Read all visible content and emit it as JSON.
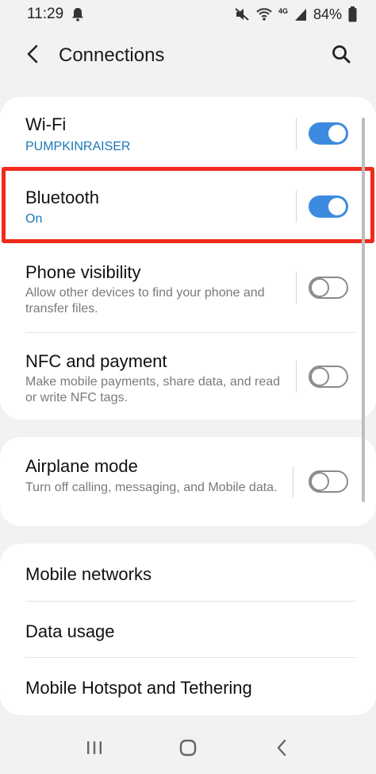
{
  "status_bar": {
    "time": "11:29",
    "network_label": "4G",
    "battery": "84%",
    "icons": [
      "notification-bell-icon",
      "mute-icon",
      "wifi-icon",
      "signal-icon",
      "battery-icon"
    ]
  },
  "header": {
    "title": "Connections",
    "back_icon": "back-arrow-icon",
    "search_icon": "search-icon"
  },
  "settings": {
    "wifi": {
      "title": "Wi-Fi",
      "subtitle": "PUMPKINRAISER",
      "enabled": true
    },
    "bluetooth": {
      "title": "Bluetooth",
      "subtitle": "On",
      "enabled": true
    },
    "phone_visibility": {
      "title": "Phone visibility",
      "description": "Allow other devices to find your phone and transfer files.",
      "enabled": false
    },
    "nfc": {
      "title": "NFC and payment",
      "description": "Make mobile payments, share data, and read or write NFC tags.",
      "enabled": false
    },
    "airplane": {
      "title": "Airplane mode",
      "description": "Turn off calling, messaging, and Mobile data.",
      "enabled": false
    },
    "mobile_networks": {
      "title": "Mobile networks"
    },
    "data_usage": {
      "title": "Data usage"
    },
    "hotspot": {
      "title": "Mobile Hotspot and Tethering"
    }
  },
  "colors": {
    "accent": "#3d8be0",
    "link": "#1a79b8",
    "highlight": "#ee2b1d"
  },
  "nav_bar": {
    "icons": [
      "recent-apps-icon",
      "home-icon",
      "back-icon"
    ]
  }
}
